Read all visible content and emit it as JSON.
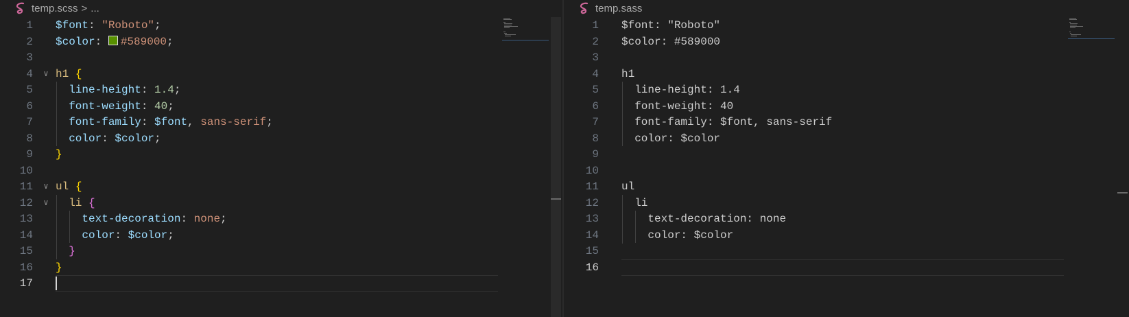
{
  "colors": {
    "background": "#1f1f1f",
    "sass_icon": "#cd6799",
    "swatch": "#589000"
  },
  "left": {
    "breadcrumb": {
      "icon": "sass-icon",
      "file": "temp.scss",
      "separator": ">",
      "more": "..."
    },
    "lines": [
      {
        "n": "1",
        "fold": false,
        "tokens": [
          {
            "t": "$font",
            "c": "var"
          },
          {
            "t": ": ",
            "c": "punc"
          },
          {
            "t": "\"Roboto\"",
            "c": "str"
          },
          {
            "t": ";",
            "c": "punc"
          }
        ]
      },
      {
        "n": "2",
        "fold": false,
        "tokens": [
          {
            "t": "$color",
            "c": "var"
          },
          {
            "t": ": ",
            "c": "punc"
          },
          {
            "swatch": "#589000"
          },
          {
            "t": "#589000",
            "c": "str"
          },
          {
            "t": ";",
            "c": "punc"
          }
        ]
      },
      {
        "n": "3",
        "fold": false,
        "tokens": []
      },
      {
        "n": "4",
        "fold": true,
        "tokens": [
          {
            "t": "h1 ",
            "c": "sel"
          },
          {
            "t": "{",
            "c": "brace-y"
          }
        ]
      },
      {
        "n": "5",
        "fold": false,
        "tokens": [
          {
            "t": "  line-height",
            "c": "prop"
          },
          {
            "t": ": ",
            "c": "punc"
          },
          {
            "t": "1.4",
            "c": "num"
          },
          {
            "t": ";",
            "c": "punc"
          }
        ]
      },
      {
        "n": "6",
        "fold": false,
        "tokens": [
          {
            "t": "  font-weight",
            "c": "prop"
          },
          {
            "t": ": ",
            "c": "punc"
          },
          {
            "t": "40",
            "c": "num"
          },
          {
            "t": ";",
            "c": "punc"
          }
        ]
      },
      {
        "n": "7",
        "fold": false,
        "tokens": [
          {
            "t": "  font-family",
            "c": "prop"
          },
          {
            "t": ": ",
            "c": "punc"
          },
          {
            "t": "$font",
            "c": "var"
          },
          {
            "t": ", ",
            "c": "punc"
          },
          {
            "t": "sans-serif",
            "c": "val"
          },
          {
            "t": ";",
            "c": "punc"
          }
        ]
      },
      {
        "n": "8",
        "fold": false,
        "tokens": [
          {
            "t": "  color",
            "c": "prop"
          },
          {
            "t": ": ",
            "c": "punc"
          },
          {
            "t": "$color",
            "c": "var"
          },
          {
            "t": ";",
            "c": "punc"
          }
        ]
      },
      {
        "n": "9",
        "fold": false,
        "tokens": [
          {
            "t": "}",
            "c": "brace-y"
          }
        ]
      },
      {
        "n": "10",
        "fold": false,
        "tokens": []
      },
      {
        "n": "11",
        "fold": true,
        "tokens": [
          {
            "t": "ul ",
            "c": "sel"
          },
          {
            "t": "{",
            "c": "brace-y"
          }
        ]
      },
      {
        "n": "12",
        "fold": true,
        "tokens": [
          {
            "t": "  li ",
            "c": "sel"
          },
          {
            "t": "{",
            "c": "brace-p"
          }
        ]
      },
      {
        "n": "13",
        "fold": false,
        "tokens": [
          {
            "t": "    text-decoration",
            "c": "prop"
          },
          {
            "t": ": ",
            "c": "punc"
          },
          {
            "t": "none",
            "c": "val"
          },
          {
            "t": ";",
            "c": "punc"
          }
        ]
      },
      {
        "n": "14",
        "fold": false,
        "tokens": [
          {
            "t": "    color",
            "c": "prop"
          },
          {
            "t": ": ",
            "c": "punc"
          },
          {
            "t": "$color",
            "c": "var"
          },
          {
            "t": ";",
            "c": "punc"
          }
        ]
      },
      {
        "n": "15",
        "fold": false,
        "tokens": [
          {
            "t": "  }",
            "c": "brace-p"
          }
        ]
      },
      {
        "n": "16",
        "fold": false,
        "tokens": [
          {
            "t": "}",
            "c": "brace-y"
          }
        ]
      },
      {
        "n": "17",
        "fold": false,
        "tokens": []
      }
    ],
    "active_line": "17"
  },
  "right": {
    "breadcrumb": {
      "icon": "sass-icon",
      "file": "temp.sass"
    },
    "lines": [
      {
        "n": "1",
        "tokens": [
          {
            "t": "$font: \"Roboto\"",
            "c": "plain"
          }
        ]
      },
      {
        "n": "2",
        "tokens": [
          {
            "t": "$color: #589000",
            "c": "plain"
          }
        ]
      },
      {
        "n": "3",
        "tokens": []
      },
      {
        "n": "4",
        "tokens": [
          {
            "t": "h1",
            "c": "plain"
          }
        ]
      },
      {
        "n": "5",
        "tokens": [
          {
            "t": "  line-height: 1.4",
            "c": "plain"
          }
        ]
      },
      {
        "n": "6",
        "tokens": [
          {
            "t": "  font-weight: 40",
            "c": "plain"
          }
        ]
      },
      {
        "n": "7",
        "tokens": [
          {
            "t": "  font-family: $font, sans-serif",
            "c": "plain"
          }
        ]
      },
      {
        "n": "8",
        "tokens": [
          {
            "t": "  color: $color",
            "c": "plain"
          }
        ]
      },
      {
        "n": "9",
        "tokens": []
      },
      {
        "n": "10",
        "tokens": []
      },
      {
        "n": "11",
        "tokens": [
          {
            "t": "ul",
            "c": "plain"
          }
        ]
      },
      {
        "n": "12",
        "tokens": [
          {
            "t": "  li",
            "c": "plain"
          }
        ]
      },
      {
        "n": "13",
        "tokens": [
          {
            "t": "    text-decoration: none",
            "c": "plain"
          }
        ]
      },
      {
        "n": "14",
        "tokens": [
          {
            "t": "    color: $color",
            "c": "plain"
          }
        ]
      },
      {
        "n": "15",
        "tokens": []
      },
      {
        "n": "16",
        "tokens": []
      }
    ],
    "active_line": "16"
  }
}
